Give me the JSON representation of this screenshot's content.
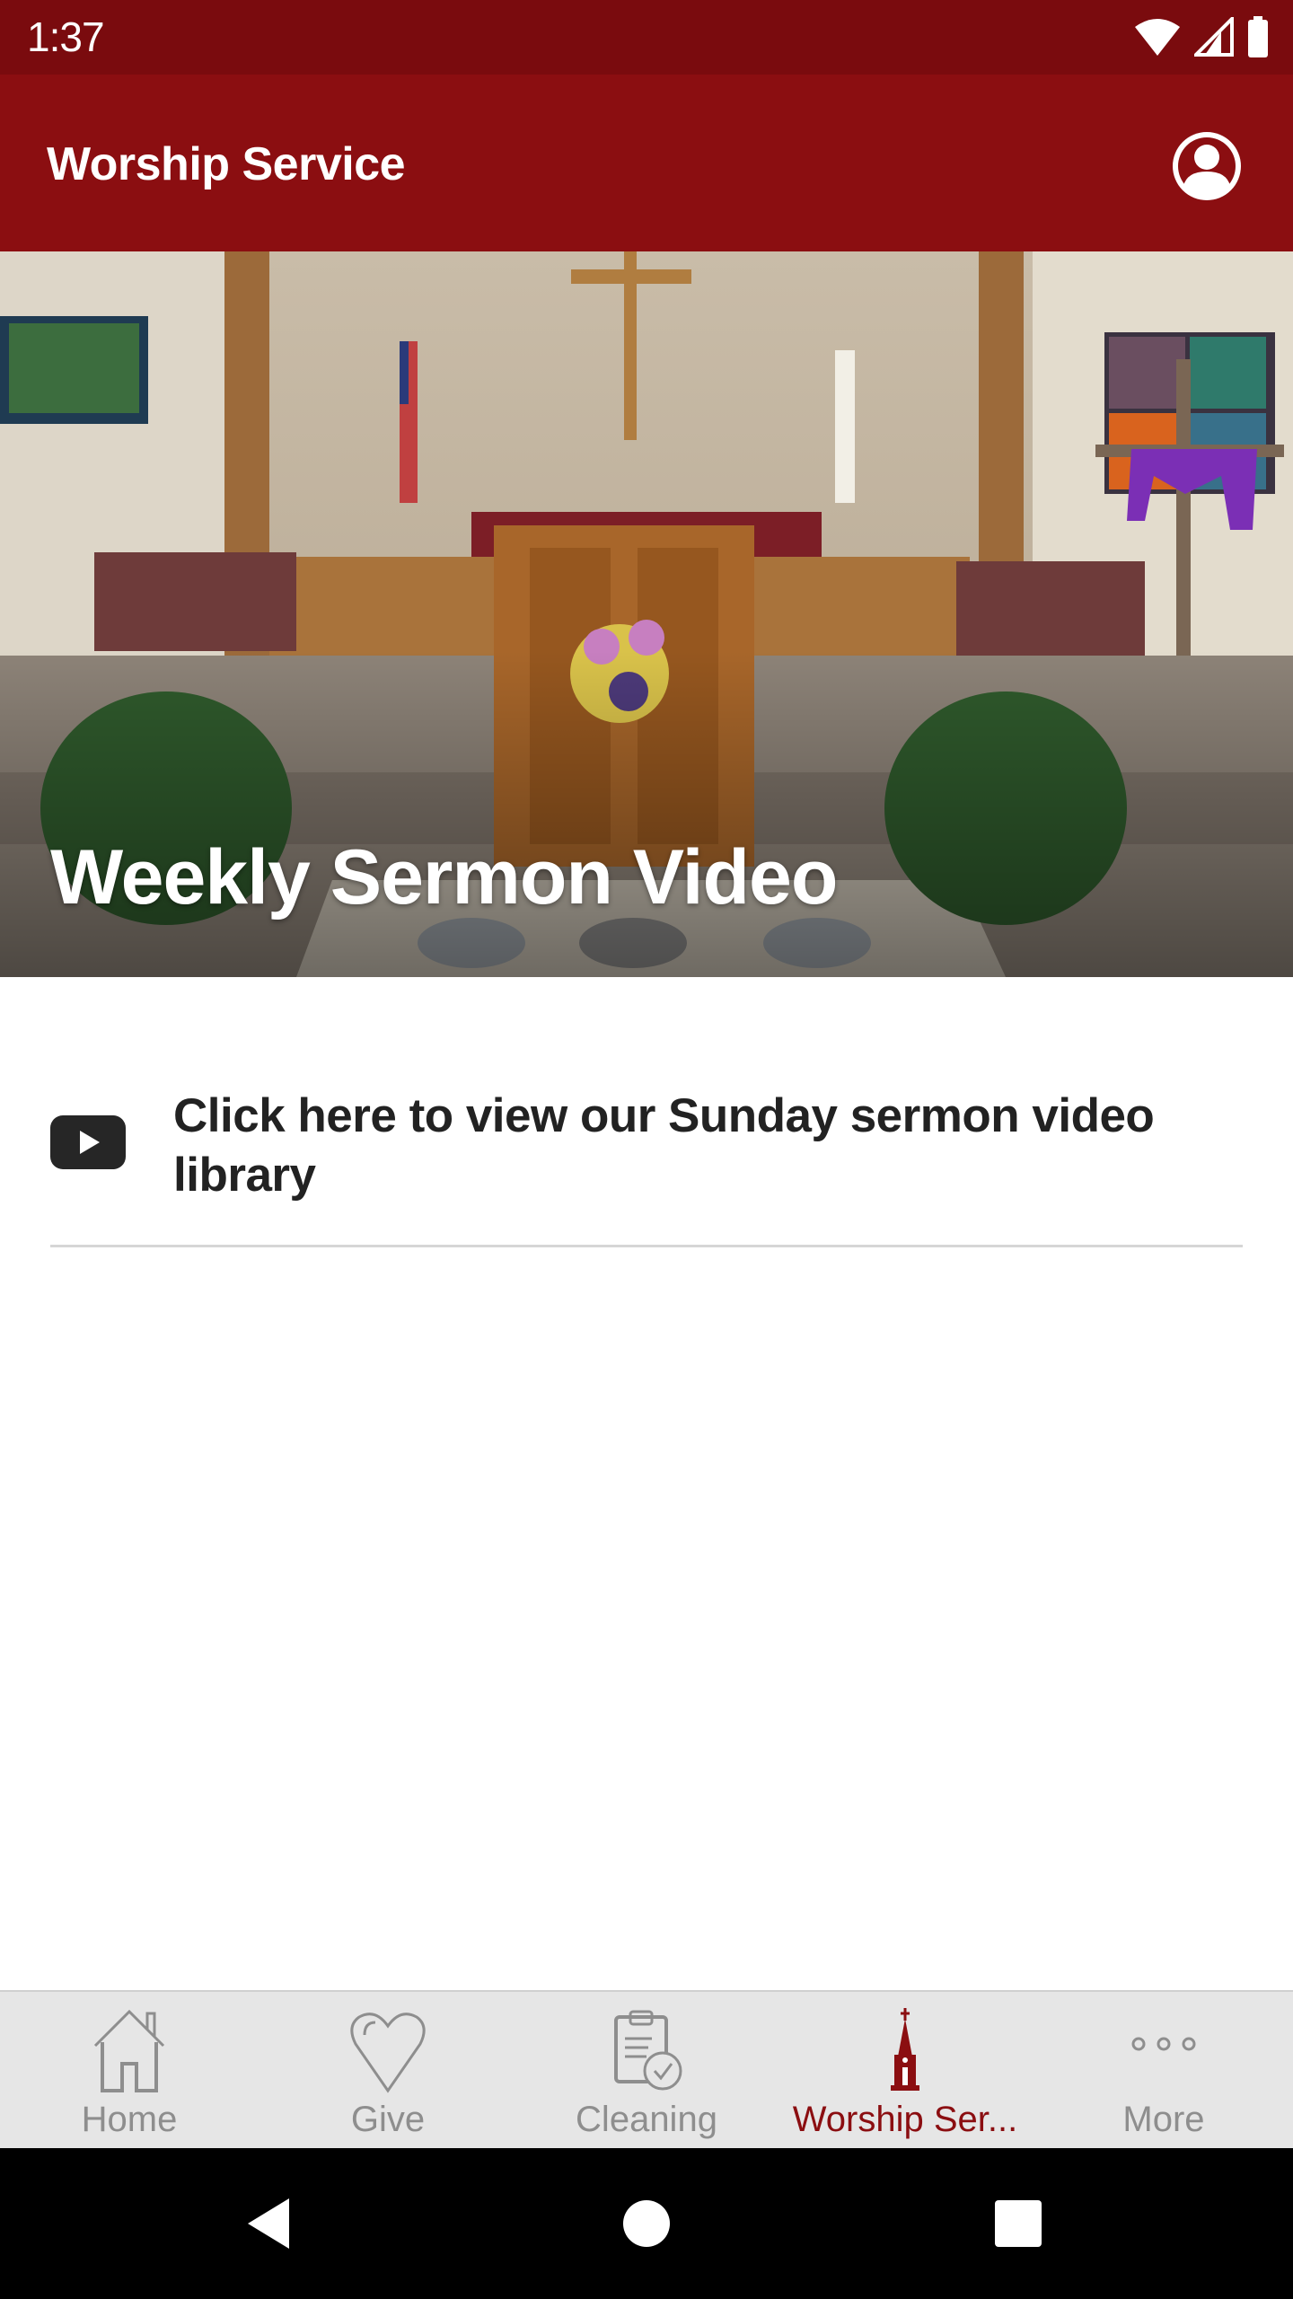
{
  "status_bar": {
    "time": "1:37",
    "icons": [
      "wifi-icon",
      "cell-signal-icon",
      "battery-icon"
    ]
  },
  "app_bar": {
    "title": "Worship Service",
    "profile_icon": "account-circle-icon",
    "background_color": "#8b0e11"
  },
  "hero": {
    "title": "Weekly Sermon Video",
    "image_description": "Church sanctuary with cross, pulpit, flags, flowers and ferns"
  },
  "list": {
    "items": [
      {
        "icon": "youtube-icon",
        "label": "Click here to view our Sunday sermon video library"
      }
    ]
  },
  "tab_bar": {
    "active_color": "#8b0e11",
    "inactive_color": "#8e8e8e",
    "tabs": [
      {
        "label": "Home",
        "icon": "home-icon",
        "active": false
      },
      {
        "label": "Give",
        "icon": "heart-icon",
        "active": false
      },
      {
        "label": "Cleaning",
        "icon": "clipboard-check-icon",
        "active": false
      },
      {
        "label": "Worship Ser...",
        "icon": "church-icon",
        "active": true
      },
      {
        "label": "More",
        "icon": "more-dots-icon",
        "active": false
      }
    ]
  },
  "nav_bar": {
    "buttons": [
      "back",
      "home",
      "recents"
    ]
  }
}
